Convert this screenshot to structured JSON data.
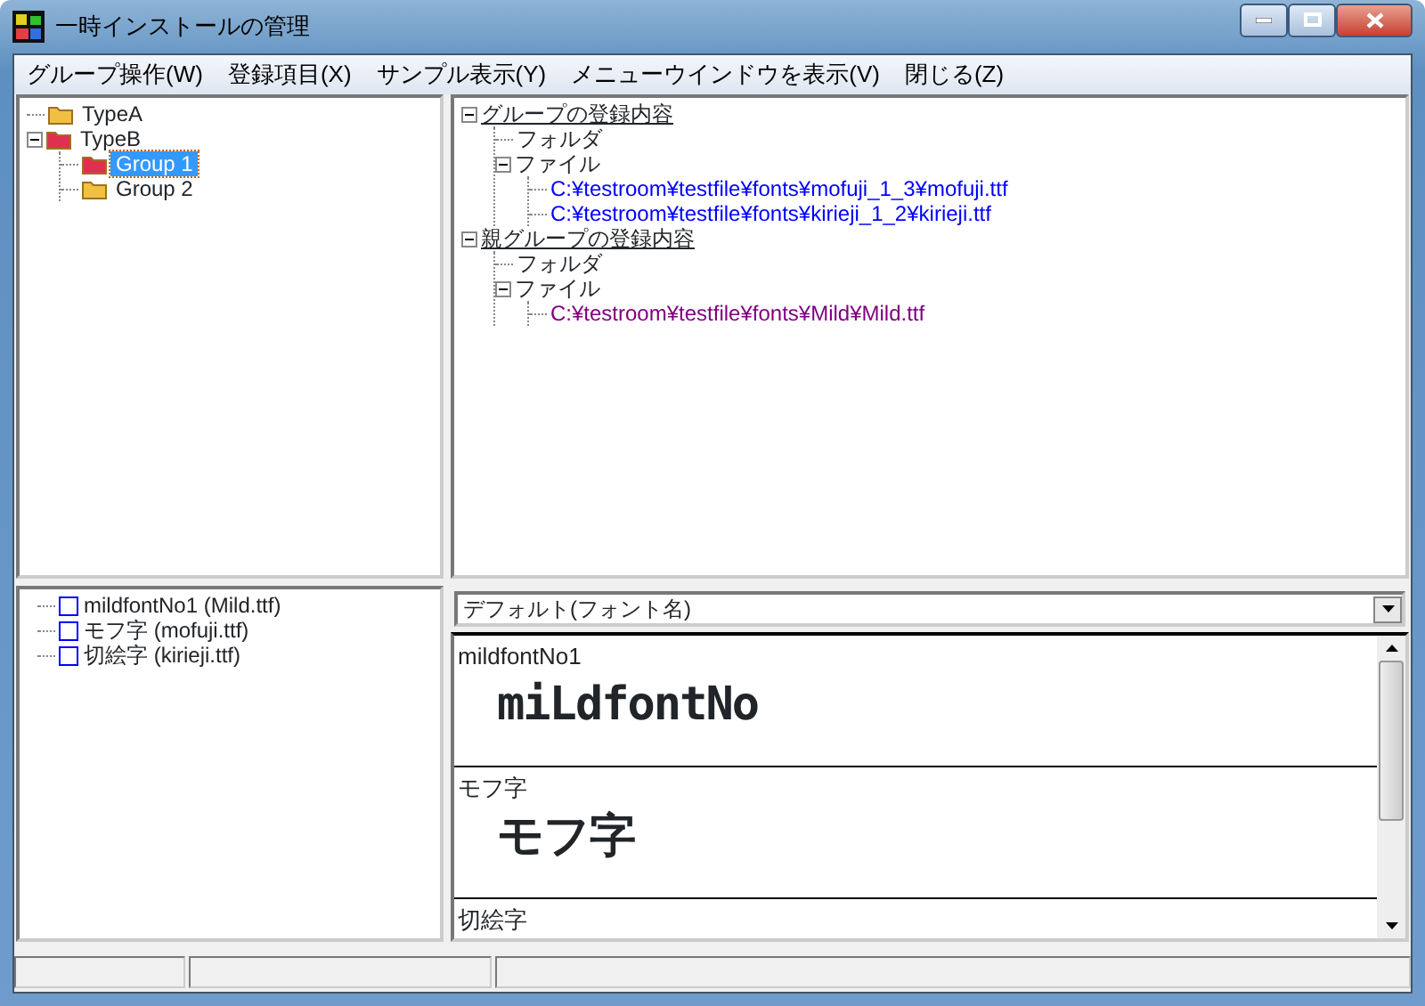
{
  "window": {
    "title": "一時インストールの管理"
  },
  "menu": [
    "グループ操作(W)",
    "登録項目(X)",
    "サンプル表示(Y)",
    "メニューウインドウを表示(V)",
    "閉じる(Z)"
  ],
  "group_tree": [
    {
      "label": "TypeA",
      "color": "#f0c040",
      "selected": false,
      "expanded": false
    },
    {
      "label": "TypeB",
      "color": "#e03050",
      "selected": false,
      "expanded": true,
      "children": [
        {
          "label": "Group 1",
          "color": "#e03050",
          "selected": true,
          "expanded": false
        },
        {
          "label": "Group 2",
          "color": "#f0c040",
          "selected": false,
          "expanded": false
        }
      ]
    }
  ],
  "content_tree": [
    {
      "label": "グループの登録内容",
      "kind": "heading",
      "expanded": true,
      "children": [
        {
          "label": "フォルダ",
          "kind": "label",
          "expanded": false
        },
        {
          "label": "ファイル",
          "kind": "label",
          "expanded": true,
          "children": [
            {
              "label": "C:¥testroom¥testfile¥fonts¥mofuji_1_3¥mofuji.ttf",
              "kind": "path",
              "color": "#0000ff",
              "expanded": false
            },
            {
              "label": "C:¥testroom¥testfile¥fonts¥kirieji_1_2¥kirieji.ttf",
              "kind": "path",
              "color": "#0000ff",
              "expanded": false
            }
          ]
        }
      ]
    },
    {
      "label": "親グループの登録内容",
      "kind": "heading",
      "expanded": true,
      "children": [
        {
          "label": "フォルダ",
          "kind": "label",
          "expanded": false
        },
        {
          "label": "ファイル",
          "kind": "label",
          "expanded": true,
          "children": [
            {
              "label": "C:¥testroom¥testfile¥fonts¥Mild¥Mild.ttf",
              "kind": "path",
              "color": "#800080",
              "expanded": false
            }
          ]
        }
      ]
    }
  ],
  "font_list": [
    {
      "label": "mildfontNo1 (Mild.ttf)",
      "checked": false
    },
    {
      "label": "モフ字 (mofuji.ttf)",
      "checked": false
    },
    {
      "label": "切絵字 (kirieji.ttf)",
      "checked": false
    }
  ],
  "sample_mode": {
    "value": "デフォルト(フォント名)"
  },
  "samples": [
    {
      "name": "mildfontNo1",
      "kind": "text",
      "sample": "miLdfontNo"
    },
    {
      "name": "モフ字",
      "kind": "text",
      "sample": "モフ字"
    },
    {
      "name": "切絵字",
      "kind": "cut"
    }
  ]
}
